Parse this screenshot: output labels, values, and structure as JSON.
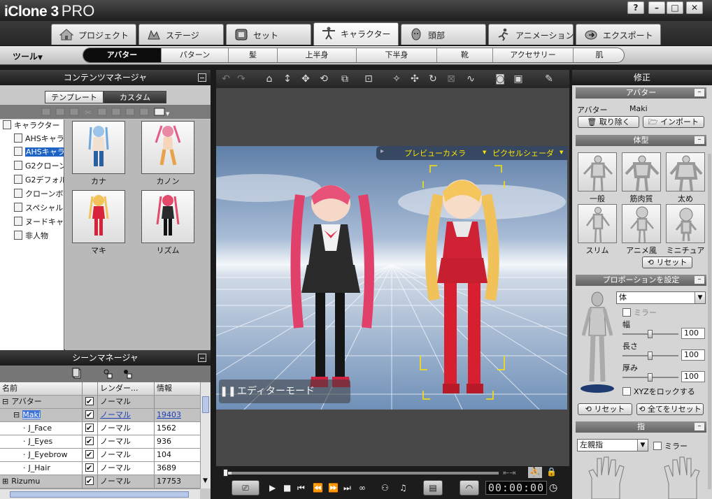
{
  "window": {
    "title_main": "iClone 3",
    "title_edition": "PRO",
    "buttons": [
      "?",
      "–",
      "□",
      "✕"
    ]
  },
  "main_tabs": [
    {
      "label": "プロジェクト",
      "icon": "house-icon"
    },
    {
      "label": "ステージ",
      "icon": "stage-icon"
    },
    {
      "label": "セット",
      "icon": "set-icon"
    },
    {
      "label": "キャラクター",
      "icon": "character-icon",
      "active": true
    },
    {
      "label": "頭部",
      "icon": "head-icon"
    },
    {
      "label": "アニメーション",
      "icon": "animation-icon"
    },
    {
      "label": "エクスポート",
      "icon": "export-icon"
    }
  ],
  "sub_bar": {
    "tools_label": "ツール",
    "tabs": [
      "アバター",
      "パターン",
      "髪",
      "上半身",
      "下半身",
      "靴",
      "アクセサリー",
      "肌"
    ],
    "active": "アバター"
  },
  "content_manager": {
    "title": "コンテンツマネージャ",
    "toggle": {
      "template": "テンプレート",
      "custom": "カスタム",
      "active": "template"
    },
    "tree": {
      "root": "キャラクター",
      "items": [
        "AHSキャラ",
        "AHSキャラ",
        "G2クローン",
        "G2デフォル",
        "クローンボ",
        "スペシャル",
        "ヌードキャ",
        "非人物"
      ],
      "selected_index": 1
    },
    "thumbnails": [
      "カナ",
      "カノン",
      "マキ",
      "リズム"
    ]
  },
  "scene_manager": {
    "title": "シーンマネージャ",
    "columns": [
      "名前",
      "",
      "レンダー...",
      "情報"
    ],
    "rows": [
      {
        "name": "アバター",
        "render": "ノーマル",
        "info": "",
        "type": "group",
        "prefix": "⊟"
      },
      {
        "name": "Maki",
        "render": "ノーマル",
        "info": "19403",
        "type": "selected",
        "prefix": "⊟"
      },
      {
        "name": "J_Face",
        "render": "ノーマル",
        "info": "1562",
        "type": "child",
        "prefix": "·"
      },
      {
        "name": "J_Eyes",
        "render": "ノーマル",
        "info": "936",
        "type": "child",
        "prefix": "·"
      },
      {
        "name": "J_Eyebrow",
        "render": "ノーマル",
        "info": "104",
        "type": "child",
        "prefix": "·"
      },
      {
        "name": "J_Hair",
        "render": "ノーマル",
        "info": "3689",
        "type": "child",
        "prefix": "·"
      },
      {
        "name": "Rizumu",
        "render": "ノーマル",
        "info": "17753",
        "type": "group2",
        "prefix": "⊞"
      }
    ]
  },
  "viewport": {
    "camera_label": "プレビューカメラ",
    "shader_label": "ピクセルシェーダ",
    "mode_label": "エディターモード",
    "pause_symbol": "❚❚",
    "time": "00:00:00",
    "progress": 0.02
  },
  "modify": {
    "title": "修正",
    "avatar_section": "アバター",
    "avatar_label": "アバター",
    "avatar_name": "Maki",
    "remove_btn": "取り除く",
    "import_btn": "インポート",
    "body_section": "体型",
    "body_types": [
      "一般",
      "筋肉質",
      "太め",
      "スリム",
      "アニメ風",
      "ミニチュア"
    ],
    "reset_btn": "リセット",
    "proportion_section": "プロポーションを設定",
    "part_select": "体",
    "mirror_label": "ミラー",
    "sliders": [
      {
        "label": "幅",
        "value": "100"
      },
      {
        "label": "長さ",
        "value": "100"
      },
      {
        "label": "厚み",
        "value": "100"
      }
    ],
    "lock_xyz": "XYZをロックする",
    "reset_all_btn": "全てをリセット",
    "finger_section": "指",
    "finger_select": "左親指",
    "finger_mirror": "ミラー"
  }
}
